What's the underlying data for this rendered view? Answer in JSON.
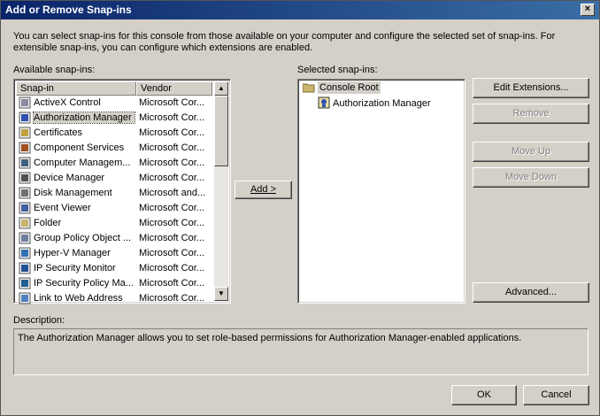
{
  "window": {
    "title": "Add or Remove Snap-ins",
    "close_glyph": "×"
  },
  "intro_text": "You can select snap-ins for this console from those available on your computer and configure the selected set of snap-ins. For extensible snap-ins, you can configure which extensions are enabled.",
  "available": {
    "label": "Available snap-ins:",
    "columns": {
      "name": "Snap-in",
      "vendor": "Vendor"
    },
    "items": [
      {
        "name": "ActiveX Control",
        "vendor": "Microsoft Cor...",
        "icon": "activex-icon"
      },
      {
        "name": "Authorization Manager",
        "vendor": "Microsoft Cor...",
        "icon": "authorization-manager-icon",
        "selected": true
      },
      {
        "name": "Certificates",
        "vendor": "Microsoft Cor...",
        "icon": "certificates-icon"
      },
      {
        "name": "Component Services",
        "vendor": "Microsoft Cor...",
        "icon": "component-services-icon"
      },
      {
        "name": "Computer Managem...",
        "vendor": "Microsoft Cor...",
        "icon": "computer-management-icon"
      },
      {
        "name": "Device Manager",
        "vendor": "Microsoft Cor...",
        "icon": "device-manager-icon"
      },
      {
        "name": "Disk Management",
        "vendor": "Microsoft and...",
        "icon": "disk-management-icon"
      },
      {
        "name": "Event Viewer",
        "vendor": "Microsoft Cor...",
        "icon": "event-viewer-icon"
      },
      {
        "name": "Folder",
        "vendor": "Microsoft Cor...",
        "icon": "folder-icon"
      },
      {
        "name": "Group Policy Object ...",
        "vendor": "Microsoft Cor...",
        "icon": "group-policy-icon"
      },
      {
        "name": "Hyper-V Manager",
        "vendor": "Microsoft Cor...",
        "icon": "hyper-v-icon"
      },
      {
        "name": "IP Security Monitor",
        "vendor": "Microsoft Cor...",
        "icon": "ip-security-monitor-icon"
      },
      {
        "name": "IP Security Policy Ma...",
        "vendor": "Microsoft Cor...",
        "icon": "ip-security-policy-icon"
      },
      {
        "name": "Link to Web Address",
        "vendor": "Microsoft Cor...",
        "icon": "web-link-icon"
      }
    ]
  },
  "add_button": "Add >",
  "selected": {
    "label": "Selected snap-ins:",
    "root": "Console Root",
    "children": [
      "Authorization Manager"
    ]
  },
  "buttons": {
    "edit_extensions": "Edit Extensions...",
    "remove": "Remove",
    "move_up": "Move Up",
    "move_down": "Move Down",
    "advanced": "Advanced...",
    "ok": "OK",
    "cancel": "Cancel"
  },
  "description": {
    "label": "Description:",
    "text": "The Authorization Manager allows you to set role-based permissions for Authorization Manager-enabled applications."
  },
  "scroll_glyphs": {
    "up": "▲",
    "down": "▼"
  }
}
